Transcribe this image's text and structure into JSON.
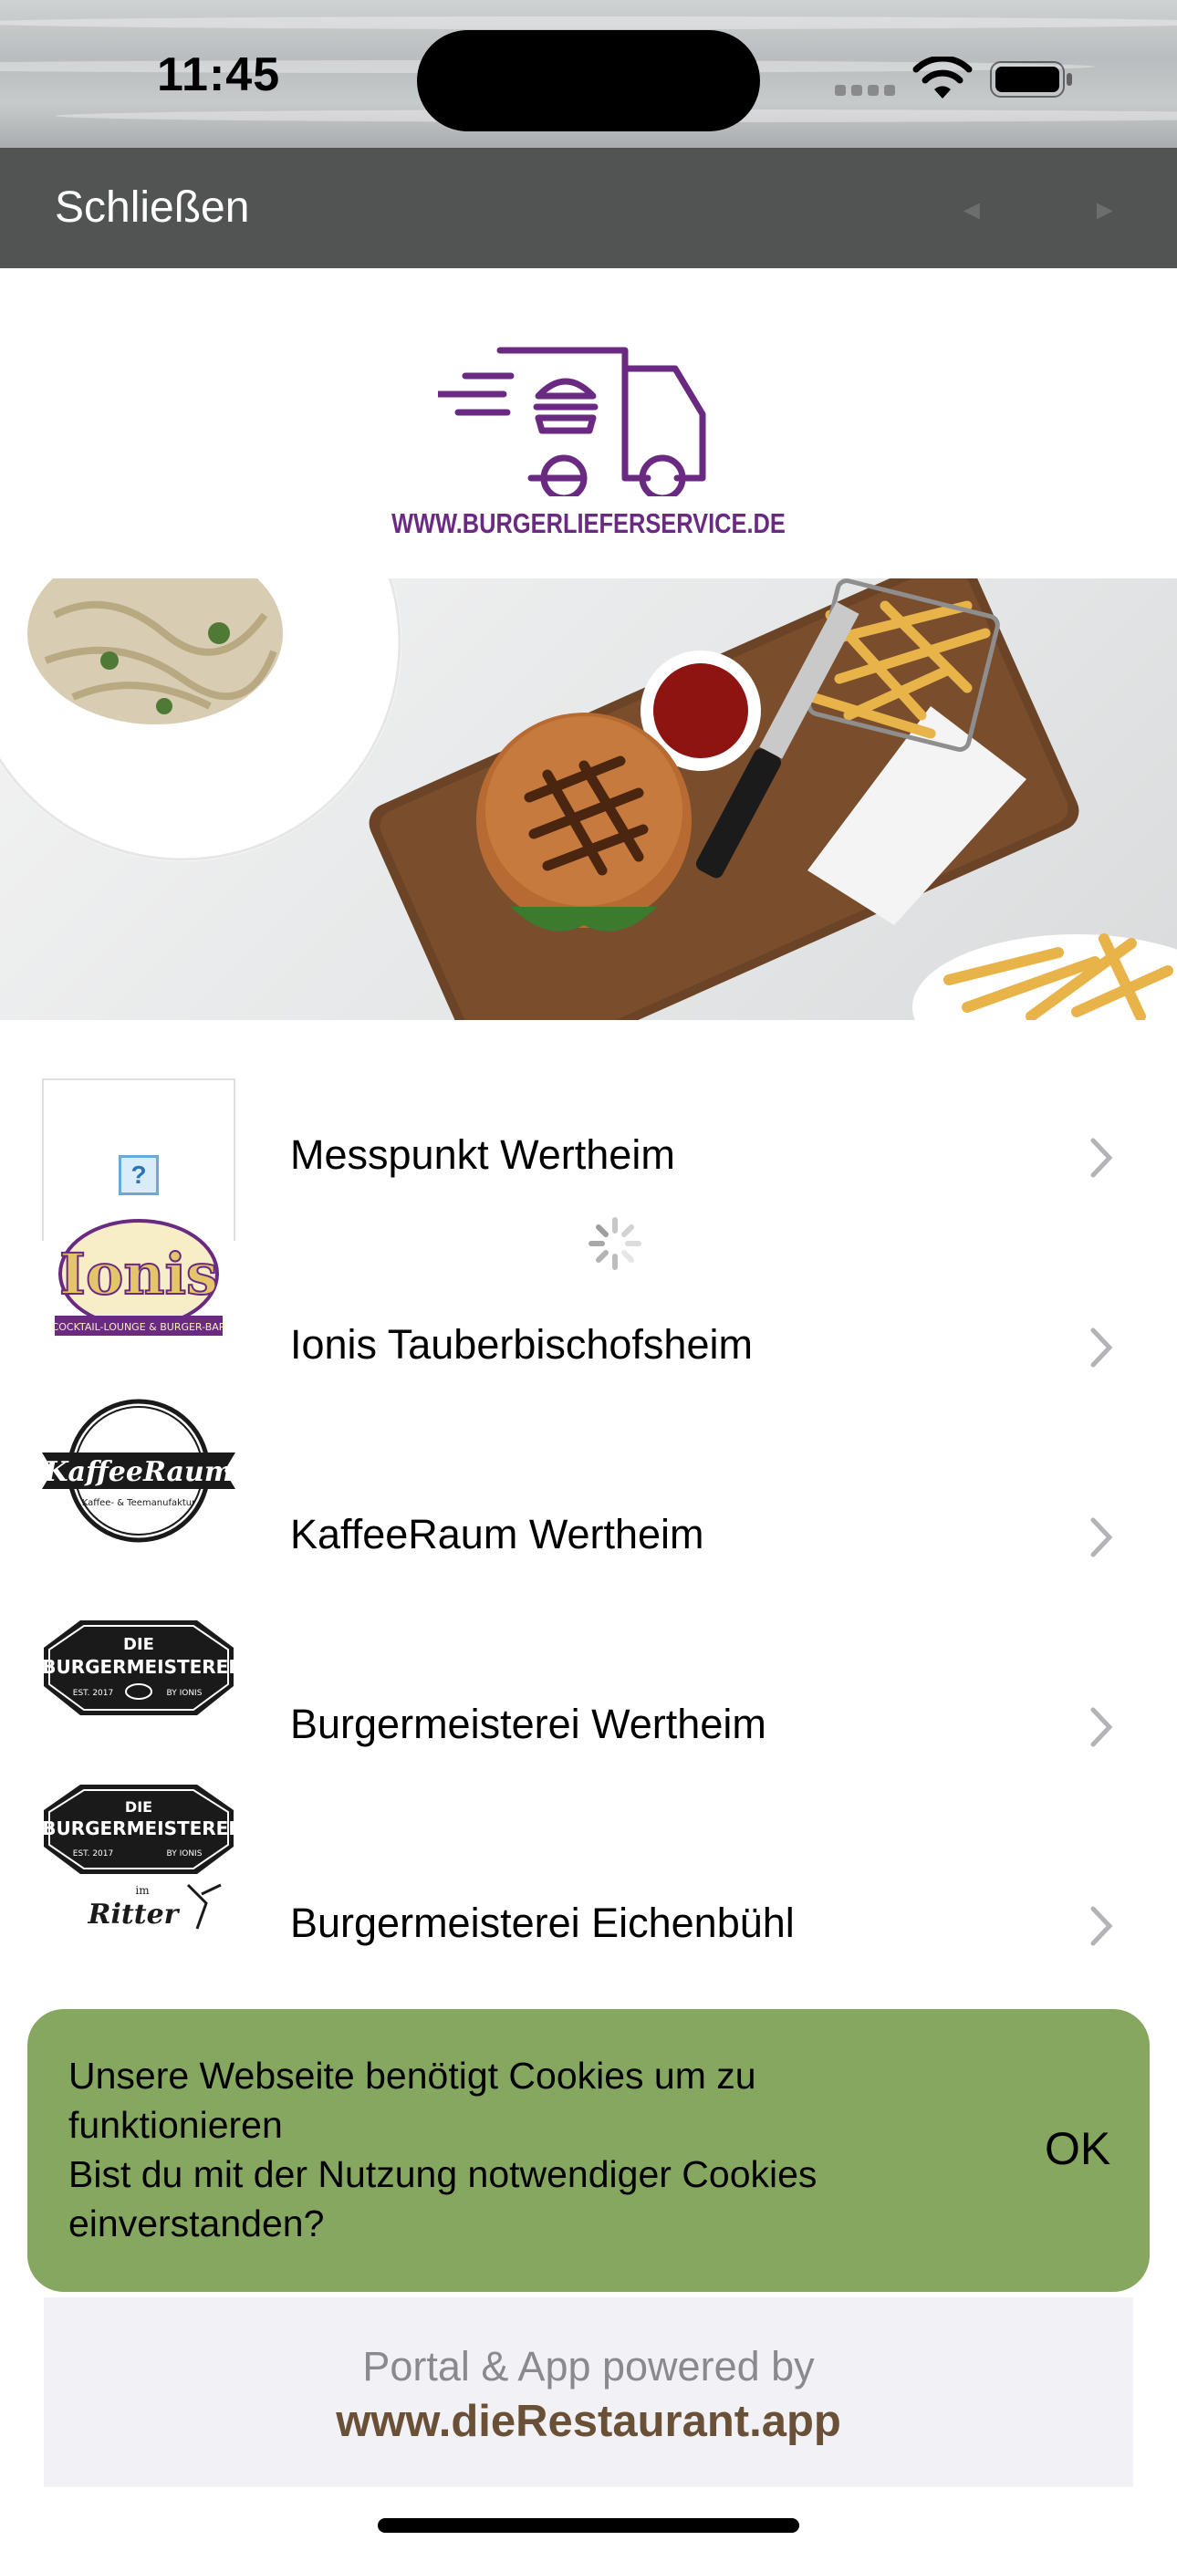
{
  "status_bar": {
    "time": "11:45",
    "icons": [
      "cellular-icon",
      "wifi-icon",
      "battery-icon"
    ]
  },
  "nav_bar": {
    "close_label": "Schließen",
    "back_glyph": "◄",
    "forward_glyph": "►"
  },
  "logo": {
    "url_text": "WWW.BURGERLIEFERSERVICE.DE",
    "color": "#6a2a82"
  },
  "restaurants": [
    {
      "name": "Messpunkt Wertheim",
      "thumb": "placeholder-icon"
    },
    {
      "name": "Ionis Tauberbischofsheim",
      "thumb": "ionis-logo",
      "logo_text": "Ionis",
      "logo_sub": "COCKTAIL-LOUNGE & BURGER-BAR"
    },
    {
      "name": "KaffeeRaum Wertheim",
      "thumb": "kaffeeraum-logo",
      "logo_text": "KaffeeRaum",
      "logo_sub": "Kaffee- & Teemanufaktur"
    },
    {
      "name": "Burgermeisterei Wertheim",
      "thumb": "burgermeisterei-logo",
      "logo_top": "DIE",
      "logo_text": "BURGERMEISTEREI",
      "logo_left": "EST. 2017",
      "logo_right": "BY IONIS"
    },
    {
      "name": "Burgermeisterei Eichenbühl",
      "thumb": "burgermeisterei-ritter-logo",
      "logo_top": "DIE",
      "logo_text": "BURGERMEISTEREI",
      "logo_left": "EST. 2017",
      "logo_right": "BY IONIS",
      "logo_extra": "Ritter",
      "logo_extra_small": "im"
    }
  ],
  "cookie_banner": {
    "line1": "Unsere Webseite benötigt Cookies um zu funktionieren",
    "line2": "Bist du mit der Nutzung notwendiger Cookies einverstanden?",
    "ok_label": "OK",
    "bg_color": "#86a75f"
  },
  "footer": {
    "line1": "Portal & App powered by",
    "line2": "www.dieRestaurant.app"
  },
  "colors": {
    "nav_bg": "#525353",
    "footer_bg": "#f2f2f6",
    "footer_link": "#6a5036"
  }
}
